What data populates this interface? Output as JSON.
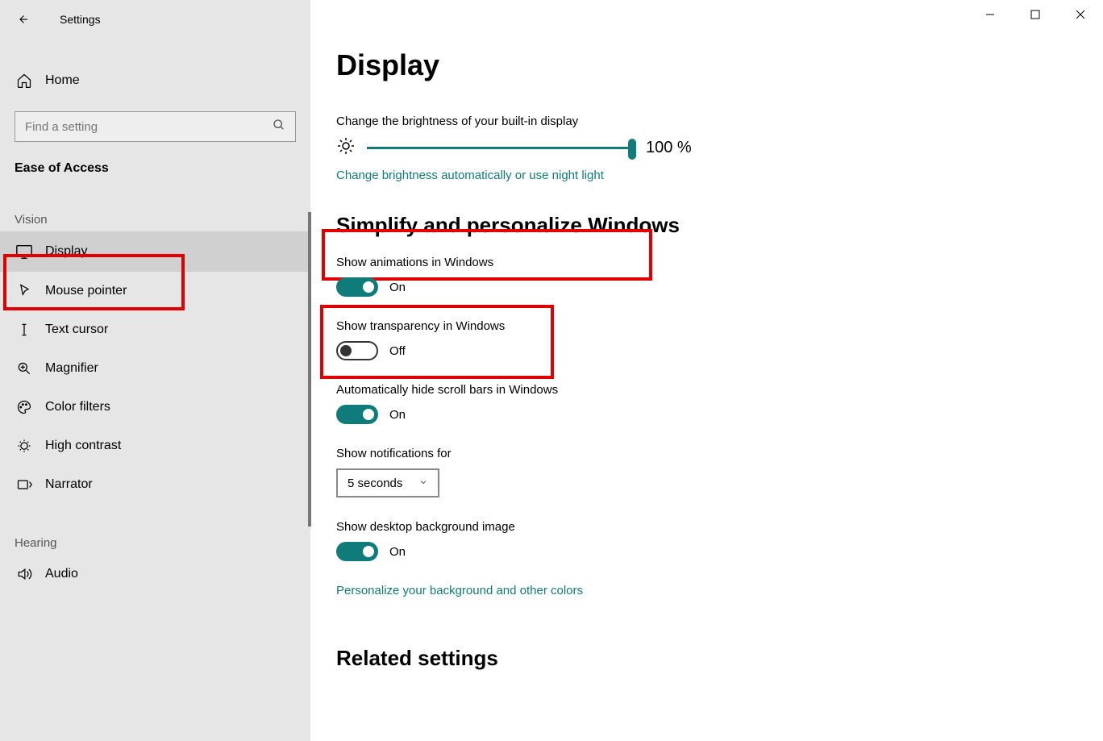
{
  "window": {
    "title": "Settings"
  },
  "sidebar": {
    "home": "Home",
    "search_placeholder": "Find a setting",
    "category": "Ease of Access",
    "groups": [
      {
        "label": "Vision",
        "items": [
          {
            "id": "display",
            "label": "Display",
            "icon": "monitor",
            "selected": true
          },
          {
            "id": "mouse-pointer",
            "label": "Mouse pointer",
            "icon": "pointer"
          },
          {
            "id": "text-cursor",
            "label": "Text cursor",
            "icon": "text-cursor"
          },
          {
            "id": "magnifier",
            "label": "Magnifier",
            "icon": "magnifier"
          },
          {
            "id": "color-filters",
            "label": "Color filters",
            "icon": "palette"
          },
          {
            "id": "high-contrast",
            "label": "High contrast",
            "icon": "contrast"
          },
          {
            "id": "narrator",
            "label": "Narrator",
            "icon": "narrator"
          }
        ]
      },
      {
        "label": "Hearing",
        "items": [
          {
            "id": "audio",
            "label": "Audio",
            "icon": "speaker"
          }
        ]
      }
    ]
  },
  "main": {
    "title": "Display",
    "brightness": {
      "label": "Change the brightness of your built-in display",
      "value_text": "100 %",
      "value_pct": 100,
      "link": "Change brightness automatically or use night light"
    },
    "simplify": {
      "title": "Simplify and personalize Windows",
      "animations": {
        "label": "Show animations in Windows",
        "on": true,
        "state": "On"
      },
      "transparency": {
        "label": "Show transparency in Windows",
        "on": false,
        "state": "Off"
      },
      "scrollbars": {
        "label": "Automatically hide scroll bars in Windows",
        "on": true,
        "state": "On"
      },
      "notifications": {
        "label": "Show notifications for",
        "selected": "5 seconds"
      },
      "desktop_bg": {
        "label": "Show desktop background image",
        "on": true,
        "state": "On"
      },
      "personalize_link": "Personalize your background and other colors"
    },
    "related_title": "Related settings"
  },
  "highlights": [
    {
      "target": "nav-display",
      "note": "selected sidebar item"
    },
    {
      "target": "section-simplify-title",
      "note": "section heading"
    },
    {
      "target": "transparency-block",
      "note": "transparency toggle off"
    }
  ],
  "colors": {
    "accent": "#0f7b7b",
    "highlight": "#e00000"
  }
}
